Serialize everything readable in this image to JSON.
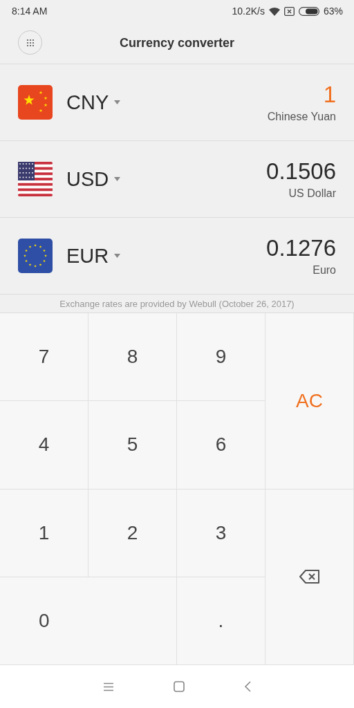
{
  "status_bar": {
    "time": "8:14 AM",
    "speed": "10.2K/s",
    "battery": "63%"
  },
  "header": {
    "title": "Currency converter"
  },
  "currencies": [
    {
      "code": "CNY",
      "name": "Chinese Yuan",
      "value": "1",
      "selected": true,
      "kind": "cn"
    },
    {
      "code": "USD",
      "name": "US Dollar",
      "value": "0.1506",
      "selected": false,
      "kind": "us"
    },
    {
      "code": "EUR",
      "name": "Euro",
      "value": "0.1276",
      "selected": false,
      "kind": "eu"
    }
  ],
  "note": "Exchange rates are provided by Webull (October 26, 2017)",
  "keys": [
    {
      "kind": "digit",
      "label": "7"
    },
    {
      "kind": "digit",
      "label": "8"
    },
    {
      "kind": "digit",
      "label": "9"
    },
    {
      "kind": "clear",
      "label": "AC"
    },
    {
      "kind": "digit",
      "label": "4"
    },
    {
      "kind": "digit",
      "label": "5"
    },
    {
      "kind": "digit",
      "label": "6"
    },
    {
      "kind": "digit",
      "label": "1"
    },
    {
      "kind": "digit",
      "label": "2"
    },
    {
      "kind": "digit",
      "label": "3"
    },
    {
      "kind": "backspace"
    },
    {
      "kind": "wide",
      "label": "0"
    },
    {
      "kind": "digit",
      "label": "."
    }
  ]
}
